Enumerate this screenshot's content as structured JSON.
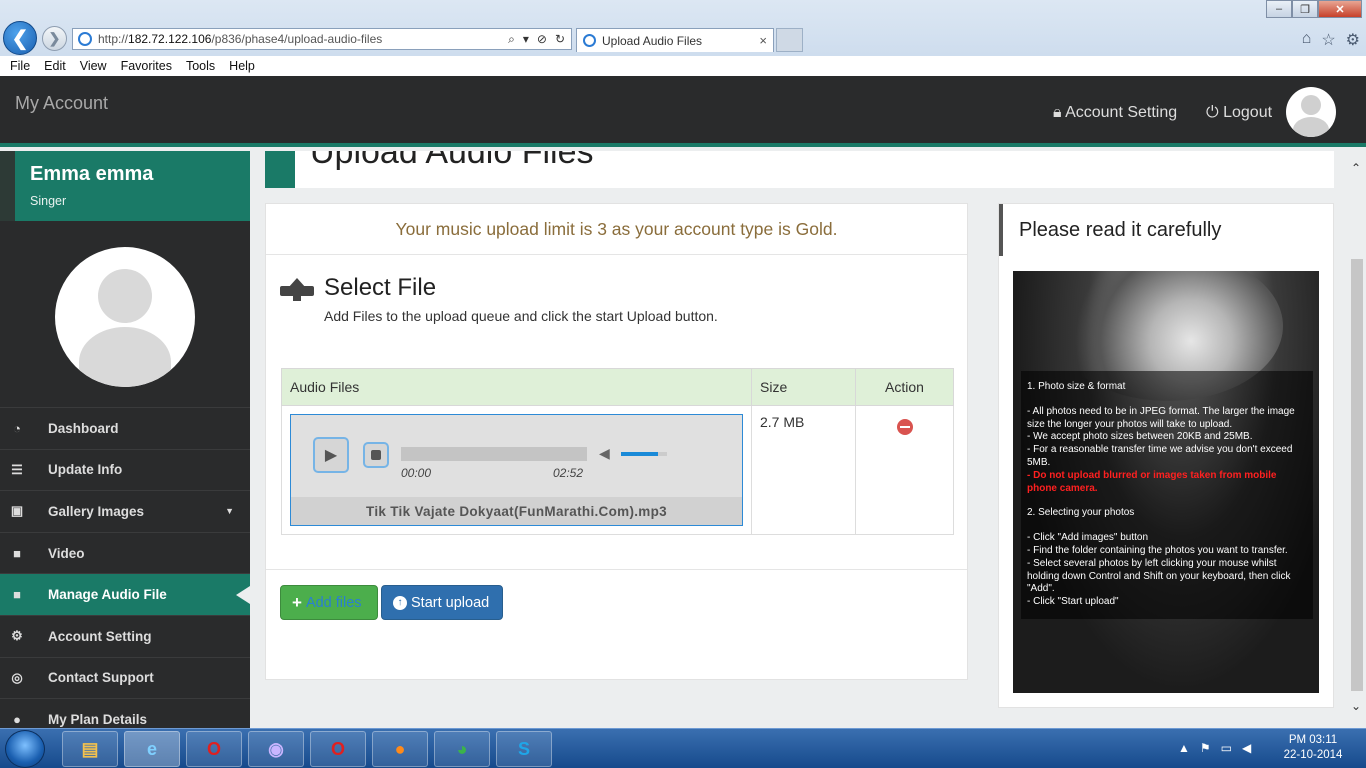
{
  "browser": {
    "url_prefix": "http://",
    "url_host": "182.72.122.106",
    "url_path": "/p836/phase4/upload-audio-files",
    "tab_title": "Upload Audio Files",
    "tab_close": "×",
    "menu": [
      "File",
      "Edit",
      "View",
      "Favorites",
      "Tools",
      "Help"
    ],
    "win_min": "–",
    "win_max": "❐",
    "win_close": "✕"
  },
  "topbar": {
    "brand": "My Account",
    "account_setting": "Account Setting",
    "logout": "Logout"
  },
  "profile": {
    "name": "Emma emma",
    "role": "Singer"
  },
  "sidebar": {
    "items": [
      {
        "label": "Dashboard",
        "icon": "dashboard-icon",
        "glyph": "◔"
      },
      {
        "label": "Update Info",
        "icon": "list-icon",
        "glyph": "☰"
      },
      {
        "label": "Gallery Images",
        "icon": "image-icon",
        "glyph": "▣"
      },
      {
        "label": "Video",
        "icon": "video-icon",
        "glyph": "■"
      },
      {
        "label": "Manage Audio File",
        "icon": "video-icon",
        "glyph": "■"
      },
      {
        "label": "Account Setting",
        "icon": "cogs-icon",
        "glyph": "⚙"
      },
      {
        "label": "Contact Support",
        "icon": "lifebuoy-icon",
        "glyph": "◎"
      },
      {
        "label": "My Plan Details",
        "icon": "user-icon",
        "glyph": "●"
      }
    ]
  },
  "page": {
    "title": "Upload Audio Files",
    "limit_message": "Your music upload limit is 3 as your account type is Gold.",
    "select_heading": "Select File",
    "select_desc": "Add Files to the upload queue and click the start Upload button."
  },
  "table": {
    "headers": [
      "Audio Files",
      "Size",
      "Action"
    ],
    "rows": [
      {
        "file_name": "Tik Tik Vajate Dokyaat(FunMarathi.Com).mp3",
        "current_time": "00:00",
        "duration": "02:52",
        "size": "2.7 MB",
        "volume": 0.8
      }
    ]
  },
  "buttons": {
    "add_files": "Add files",
    "start_upload": "Start upload"
  },
  "info": {
    "heading": "Please read it carefully",
    "lines": [
      "1. Photo size & format",
      "- All photos need to be in JPEG format. The larger the image size the longer your photos will take to upload.",
      "- We accept photo sizes between 20KB and 25MB.",
      "- For a reasonable transfer time we advise you don't exceed 5MB.",
      "- Do not upload blurred or images taken from mobile phone camera.",
      "2. Selecting your photos",
      "- Click \"Add images\" button",
      "- Find the folder containing the photos you want to transfer.",
      "- Select several photos by left clicking your mouse whilst holding down Control and Shift on your keyboard, then click \"Add\".",
      "- Click \"Start upload\""
    ]
  },
  "taskbar": {
    "clock_time": "PM 03:11",
    "clock_date": "22-10-2014"
  },
  "colors": {
    "accent": "#1a7a67",
    "topbar": "#2a2b2c",
    "success": "#4cae4c",
    "primary": "#2f6fae",
    "danger": "#d9534f",
    "warning_text": "#8a6d3b"
  }
}
